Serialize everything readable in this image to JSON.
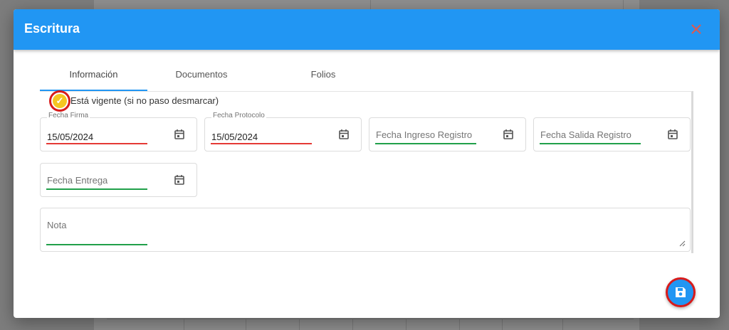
{
  "dialog": {
    "title": "Escritura",
    "close_icon": "close-icon",
    "accent_color": "#2196f3"
  },
  "tabs": [
    {
      "label": "Información",
      "active": true
    },
    {
      "label": "Documentos",
      "active": false
    },
    {
      "label": "Folios",
      "active": false
    }
  ],
  "vigente": {
    "label": "Está vigente (si no paso desmarcar)",
    "checked": true
  },
  "fields": {
    "fecha_firma": {
      "label": "Fecha Firma",
      "value": "15/05/2024"
    },
    "fecha_protocolo": {
      "label": "Fecha Protocolo",
      "value": "15/05/2024"
    },
    "fecha_ingreso_registro": {
      "placeholder": "Fecha Ingreso Registro"
    },
    "fecha_salida_registro": {
      "placeholder": "Fecha Salida Registro"
    },
    "fecha_entrega": {
      "placeholder": "Fecha Entrega"
    },
    "nota": {
      "placeholder": "Nota"
    }
  },
  "colors": {
    "error_underline": "#e53935",
    "valid_underline": "#21a04a",
    "checkbox": "#f5c623"
  },
  "save_button": {
    "icon": "floppy-disk-icon"
  }
}
